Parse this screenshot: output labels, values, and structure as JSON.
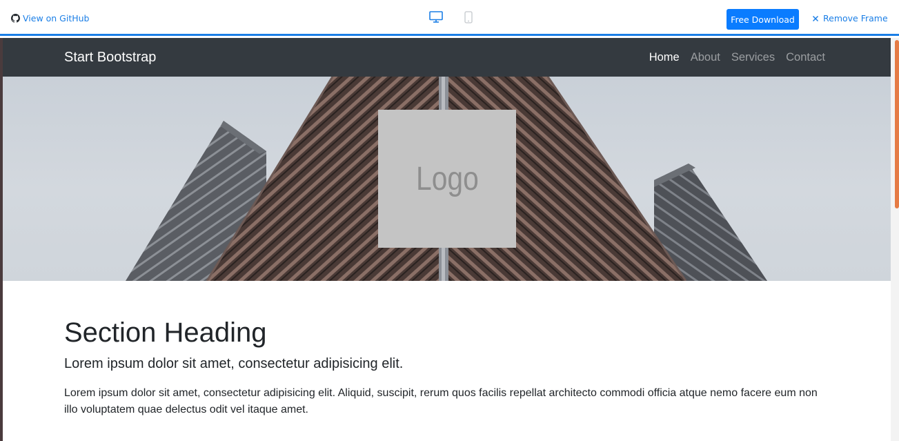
{
  "preview_bar": {
    "github_label": "View on GitHub",
    "download_label": "Free Download",
    "remove_frame_label": "Remove Frame",
    "active_device": "desktop",
    "accent_color": "#1a7ee6",
    "button_color": "#0a7cff"
  },
  "site": {
    "brand": "Start Bootstrap",
    "nav": [
      {
        "label": "Home",
        "active": true
      },
      {
        "label": "About",
        "active": false
      },
      {
        "label": "Services",
        "active": false
      },
      {
        "label": "Contact",
        "active": false
      }
    ],
    "navbar_color": "#343a40",
    "hero": {
      "logo_text": "Logo"
    },
    "section": {
      "heading": "Section Heading",
      "lead": "Lorem ipsum dolor sit amet, consectetur adipisicing elit.",
      "body": "Lorem ipsum dolor sit amet, consectetur adipisicing elit. Aliquid, suscipit, rerum quos facilis repellat architecto commodi officia atque nemo facere eum non illo voluptatem quae delectus odit vel itaque amet."
    }
  }
}
